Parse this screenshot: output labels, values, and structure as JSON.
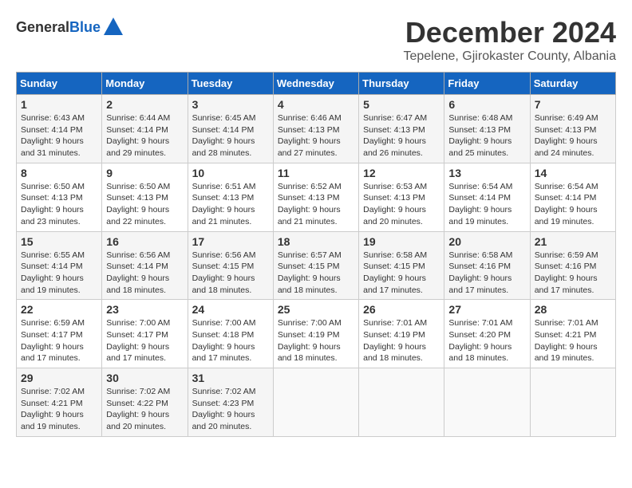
{
  "header": {
    "logo_general": "General",
    "logo_blue": "Blue",
    "title": "December 2024",
    "subtitle": "Tepelene, Gjirokaster County, Albania"
  },
  "calendar": {
    "days_of_week": [
      "Sunday",
      "Monday",
      "Tuesday",
      "Wednesday",
      "Thursday",
      "Friday",
      "Saturday"
    ],
    "weeks": [
      [
        {
          "day": "1",
          "sunrise": "Sunrise: 6:43 AM",
          "sunset": "Sunset: 4:14 PM",
          "daylight": "Daylight: 9 hours and 31 minutes."
        },
        {
          "day": "2",
          "sunrise": "Sunrise: 6:44 AM",
          "sunset": "Sunset: 4:14 PM",
          "daylight": "Daylight: 9 hours and 29 minutes."
        },
        {
          "day": "3",
          "sunrise": "Sunrise: 6:45 AM",
          "sunset": "Sunset: 4:14 PM",
          "daylight": "Daylight: 9 hours and 28 minutes."
        },
        {
          "day": "4",
          "sunrise": "Sunrise: 6:46 AM",
          "sunset": "Sunset: 4:13 PM",
          "daylight": "Daylight: 9 hours and 27 minutes."
        },
        {
          "day": "5",
          "sunrise": "Sunrise: 6:47 AM",
          "sunset": "Sunset: 4:13 PM",
          "daylight": "Daylight: 9 hours and 26 minutes."
        },
        {
          "day": "6",
          "sunrise": "Sunrise: 6:48 AM",
          "sunset": "Sunset: 4:13 PM",
          "daylight": "Daylight: 9 hours and 25 minutes."
        },
        {
          "day": "7",
          "sunrise": "Sunrise: 6:49 AM",
          "sunset": "Sunset: 4:13 PM",
          "daylight": "Daylight: 9 hours and 24 minutes."
        }
      ],
      [
        {
          "day": "8",
          "sunrise": "Sunrise: 6:50 AM",
          "sunset": "Sunset: 4:13 PM",
          "daylight": "Daylight: 9 hours and 23 minutes."
        },
        {
          "day": "9",
          "sunrise": "Sunrise: 6:50 AM",
          "sunset": "Sunset: 4:13 PM",
          "daylight": "Daylight: 9 hours and 22 minutes."
        },
        {
          "day": "10",
          "sunrise": "Sunrise: 6:51 AM",
          "sunset": "Sunset: 4:13 PM",
          "daylight": "Daylight: 9 hours and 21 minutes."
        },
        {
          "day": "11",
          "sunrise": "Sunrise: 6:52 AM",
          "sunset": "Sunset: 4:13 PM",
          "daylight": "Daylight: 9 hours and 21 minutes."
        },
        {
          "day": "12",
          "sunrise": "Sunrise: 6:53 AM",
          "sunset": "Sunset: 4:13 PM",
          "daylight": "Daylight: 9 hours and 20 minutes."
        },
        {
          "day": "13",
          "sunrise": "Sunrise: 6:54 AM",
          "sunset": "Sunset: 4:14 PM",
          "daylight": "Daylight: 9 hours and 19 minutes."
        },
        {
          "day": "14",
          "sunrise": "Sunrise: 6:54 AM",
          "sunset": "Sunset: 4:14 PM",
          "daylight": "Daylight: 9 hours and 19 minutes."
        }
      ],
      [
        {
          "day": "15",
          "sunrise": "Sunrise: 6:55 AM",
          "sunset": "Sunset: 4:14 PM",
          "daylight": "Daylight: 9 hours and 19 minutes."
        },
        {
          "day": "16",
          "sunrise": "Sunrise: 6:56 AM",
          "sunset": "Sunset: 4:14 PM",
          "daylight": "Daylight: 9 hours and 18 minutes."
        },
        {
          "day": "17",
          "sunrise": "Sunrise: 6:56 AM",
          "sunset": "Sunset: 4:15 PM",
          "daylight": "Daylight: 9 hours and 18 minutes."
        },
        {
          "day": "18",
          "sunrise": "Sunrise: 6:57 AM",
          "sunset": "Sunset: 4:15 PM",
          "daylight": "Daylight: 9 hours and 18 minutes."
        },
        {
          "day": "19",
          "sunrise": "Sunrise: 6:58 AM",
          "sunset": "Sunset: 4:15 PM",
          "daylight": "Daylight: 9 hours and 17 minutes."
        },
        {
          "day": "20",
          "sunrise": "Sunrise: 6:58 AM",
          "sunset": "Sunset: 4:16 PM",
          "daylight": "Daylight: 9 hours and 17 minutes."
        },
        {
          "day": "21",
          "sunrise": "Sunrise: 6:59 AM",
          "sunset": "Sunset: 4:16 PM",
          "daylight": "Daylight: 9 hours and 17 minutes."
        }
      ],
      [
        {
          "day": "22",
          "sunrise": "Sunrise: 6:59 AM",
          "sunset": "Sunset: 4:17 PM",
          "daylight": "Daylight: 9 hours and 17 minutes."
        },
        {
          "day": "23",
          "sunrise": "Sunrise: 7:00 AM",
          "sunset": "Sunset: 4:17 PM",
          "daylight": "Daylight: 9 hours and 17 minutes."
        },
        {
          "day": "24",
          "sunrise": "Sunrise: 7:00 AM",
          "sunset": "Sunset: 4:18 PM",
          "daylight": "Daylight: 9 hours and 17 minutes."
        },
        {
          "day": "25",
          "sunrise": "Sunrise: 7:00 AM",
          "sunset": "Sunset: 4:19 PM",
          "daylight": "Daylight: 9 hours and 18 minutes."
        },
        {
          "day": "26",
          "sunrise": "Sunrise: 7:01 AM",
          "sunset": "Sunset: 4:19 PM",
          "daylight": "Daylight: 9 hours and 18 minutes."
        },
        {
          "day": "27",
          "sunrise": "Sunrise: 7:01 AM",
          "sunset": "Sunset: 4:20 PM",
          "daylight": "Daylight: 9 hours and 18 minutes."
        },
        {
          "day": "28",
          "sunrise": "Sunrise: 7:01 AM",
          "sunset": "Sunset: 4:21 PM",
          "daylight": "Daylight: 9 hours and 19 minutes."
        }
      ],
      [
        {
          "day": "29",
          "sunrise": "Sunrise: 7:02 AM",
          "sunset": "Sunset: 4:21 PM",
          "daylight": "Daylight: 9 hours and 19 minutes."
        },
        {
          "day": "30",
          "sunrise": "Sunrise: 7:02 AM",
          "sunset": "Sunset: 4:22 PM",
          "daylight": "Daylight: 9 hours and 20 minutes."
        },
        {
          "day": "31",
          "sunrise": "Sunrise: 7:02 AM",
          "sunset": "Sunset: 4:23 PM",
          "daylight": "Daylight: 9 hours and 20 minutes."
        },
        null,
        null,
        null,
        null
      ]
    ]
  }
}
